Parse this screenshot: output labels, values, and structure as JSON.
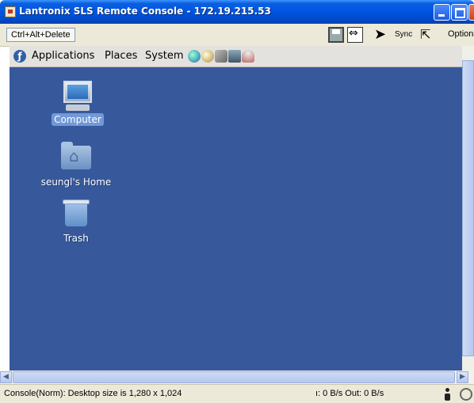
{
  "window": {
    "title": "Lantronix SLS Remote Console - 172.19.215.53"
  },
  "toolbar": {
    "ctrl_alt_delete_label": "Ctrl+Alt+Delete",
    "sync_label": "Sync",
    "options_label": "Options",
    "icons": [
      "save-icon",
      "fit-screen-icon",
      "mouse-pointer-icon",
      "single-cursor-icon"
    ]
  },
  "gnome_panel": {
    "menus": [
      "Applications",
      "Places",
      "System"
    ],
    "launchers": [
      "web-browser-icon",
      "email-icon",
      "sound-icon",
      "screenshot-icon",
      "help-icon"
    ]
  },
  "desktop": {
    "background_color": "#37599c",
    "icons": [
      {
        "label": "Computer",
        "icon": "computer-icon",
        "selected": true
      },
      {
        "label": "seungl's Home",
        "icon": "home-folder-icon",
        "selected": false
      },
      {
        "label": "Trash",
        "icon": "trash-icon",
        "selected": false
      }
    ]
  },
  "status_bar": {
    "message": "Console(Norm): Desktop size is 1,280 x 1,024",
    "network": "ı: 0 B/s Out: 0 B/s"
  }
}
